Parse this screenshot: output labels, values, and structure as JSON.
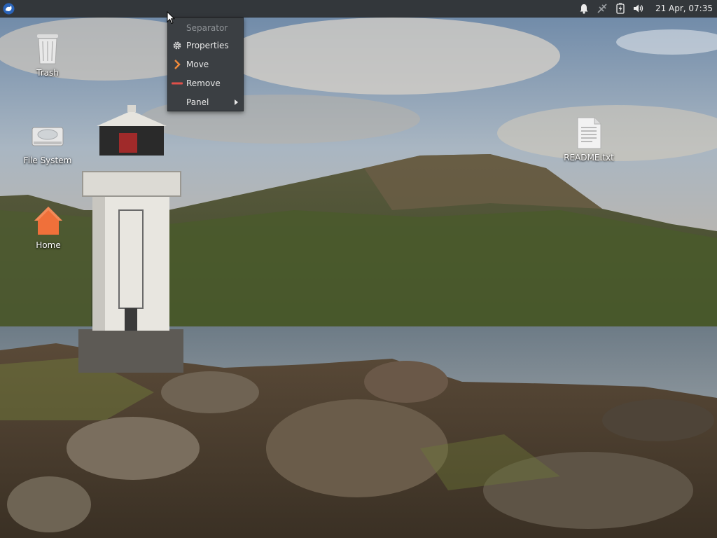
{
  "panel": {
    "clock": "21 Apr, 07:35",
    "tray_icons": [
      "notification-bell-icon",
      "network-disconnected-icon",
      "battery-charging-icon",
      "volume-icon"
    ]
  },
  "context_menu": {
    "header": "Separator",
    "items": [
      {
        "label": "Properties",
        "icon": "gear-icon"
      },
      {
        "label": "Move",
        "icon": "chevron-right-icon"
      },
      {
        "label": "Remove",
        "icon": "minus-icon"
      },
      {
        "label": "Panel",
        "icon": "",
        "has_submenu": true
      }
    ]
  },
  "desktop": {
    "icons": [
      {
        "label": "Trash",
        "icon": "trash-icon"
      },
      {
        "label": "File System",
        "icon": "hard-drive-icon"
      },
      {
        "label": "Home",
        "icon": "home-folder-icon"
      },
      {
        "label": "README.txt",
        "icon": "text-file-icon"
      }
    ]
  },
  "colors": {
    "panel_bg": "#33373b",
    "menu_bg": "#3b3f43",
    "home_icon": "#f0703a",
    "remove_icon": "#e0504a",
    "move_icon": "#f08a3a"
  }
}
